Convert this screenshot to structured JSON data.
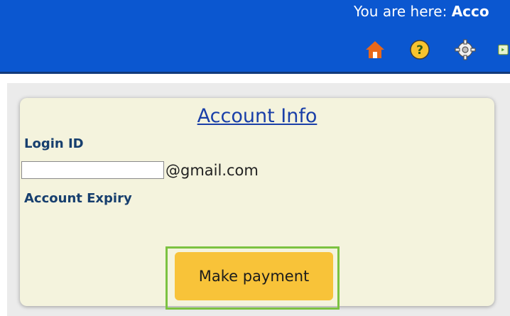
{
  "header": {
    "breadcrumb_prefix": "You are here: ",
    "breadcrumb_current": "Acco",
    "icons": [
      "home-icon",
      "help-icon",
      "gear-icon",
      "exit-icon"
    ]
  },
  "account_panel": {
    "title": "Account Info",
    "login_id_label": "Login ID",
    "login_input_value": "",
    "email_suffix": "@gmail.com",
    "account_expiry_label": "Account Expiry",
    "make_payment_label": "Make payment"
  },
  "colors": {
    "header_blue": "#0b57d0",
    "panel_bg": "#f4f3dd",
    "button_yellow": "#f8c339",
    "highlight_green": "#7cc241"
  }
}
